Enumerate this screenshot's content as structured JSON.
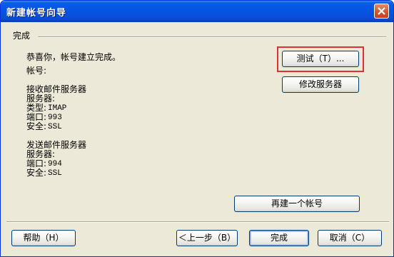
{
  "window": {
    "title": "新建帐号向导"
  },
  "group": {
    "title": "完成"
  },
  "content": {
    "congrats": "恭喜你，帐号建立完成。",
    "account_label": "帐号:",
    "incoming": {
      "heading": "接收邮件服务器",
      "server_label": "服务器:",
      "type_label": "类型:",
      "type_value": "IMAP",
      "port_label": "端口:",
      "port_value": "993",
      "security_label": "安全:",
      "security_value": "SSL"
    },
    "outgoing": {
      "heading": "发送邮件服务器",
      "server_label": "服务器:",
      "port_label": "端口:",
      "port_value": "994",
      "security_label": "安全:",
      "security_value": "SSL"
    }
  },
  "buttons": {
    "test": "测试（T）...",
    "modify_server": "修改服务器",
    "new_account": "再建一个帐号",
    "help": "帮助（H）",
    "back": "＜上一步（B）",
    "finish": "完成",
    "cancel": "取消（C）"
  },
  "highlight_color": "#e03030"
}
